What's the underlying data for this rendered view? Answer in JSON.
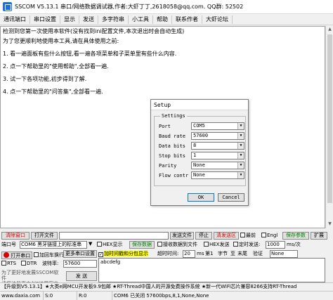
{
  "window": {
    "title": "SSCOM V5.13.1 串口/网络数据调试器,作者:大虾丁丁,2618058@qq.com. QQ群: 52502"
  },
  "menu": [
    "通讯端口",
    "串口设置",
    "显示",
    "发送",
    "多字符串",
    "小工具",
    "帮助",
    "联系作者",
    "大虾论坛"
  ],
  "main_text": [
    "检测到您第一次使用本软件(没有找到ini配置文件,本次退出时会自动生成)",
    "为了您更顺利地使用本工具,请在具体使用之前:",
    "1. 看一遍面板有些什么按钮,看一遍各项菜单和子菜单里有些什么内容.",
    "2. 点一下帮助里的\"使用帮助\",全部看一遍.",
    "3. 试一下各项功能,初步得到了解.",
    "4. 点一下帮助里的\"问答集\",全部看一遍."
  ],
  "setup_dialog": {
    "title": "Setup",
    "group_label": "Settings",
    "rows": [
      {
        "label": "Port",
        "value": "COM5"
      },
      {
        "label": "Baud rate",
        "value": "57600"
      },
      {
        "label": "Data bits",
        "value": "8"
      },
      {
        "label": "Stop bits",
        "value": "1"
      },
      {
        "label": "Parity",
        "value": "None"
      },
      {
        "label": "Flow contr",
        "value": "None"
      }
    ],
    "ok_label": "OK",
    "cancel_label": "Cancel"
  },
  "panel": {
    "clear_window": "清除窗口",
    "open_file": "打开文件",
    "send_file": "发送文件",
    "stop": "停止",
    "clear_send": "清发送区",
    "latest": "最前",
    "english": "Engl",
    "save_params": "保存参数",
    "expand": "扩展",
    "port_label": "端口号",
    "port_value": "COM6 黑牙链接上的标准串",
    "more_settings": "更多串口设置",
    "hex_display": "HEX显示",
    "save_data": "保存数据",
    "recv_to_file": "接收数据到文件",
    "hex_send": "HEX发送",
    "timed_send": "定时发送:",
    "timed_value": "1000",
    "timed_unit": "ms/次",
    "add_crlf": "加回车换行",
    "add_timestamp": "加时间戳和分包显示",
    "timeout_label": "超时时间:",
    "timeout_value": "20",
    "timeout_unit": "ms",
    "byte_index": "第1",
    "byte_unit": "字节",
    "to_label": "至",
    "verify_label": "末尾",
    "verify_value": "验证",
    "verify_none": "None",
    "open_port": "打开串口",
    "rts": "RTS",
    "dtr": "DTR",
    "baud_label": "波特率:",
    "baud_value": "57600",
    "send_btn": "发 送",
    "send_text": "abcdefg",
    "promo": "为了更好地发展SSCOM软件\n请您注册嘉立创P结尾客户"
  },
  "banner": "【升级到V5.13.1】★大类e网MCU开发板9.9包邮 ★RT-Thread中国人的开源免费操作系统 ★新一代WiFi芯片兼容8266支持RT-Thread",
  "status": {
    "website": "www.daxia.com",
    "s": "S:0",
    "r": "R:0",
    "port_status": "COM6 已关闭  57600bps,8,1,None,None"
  }
}
